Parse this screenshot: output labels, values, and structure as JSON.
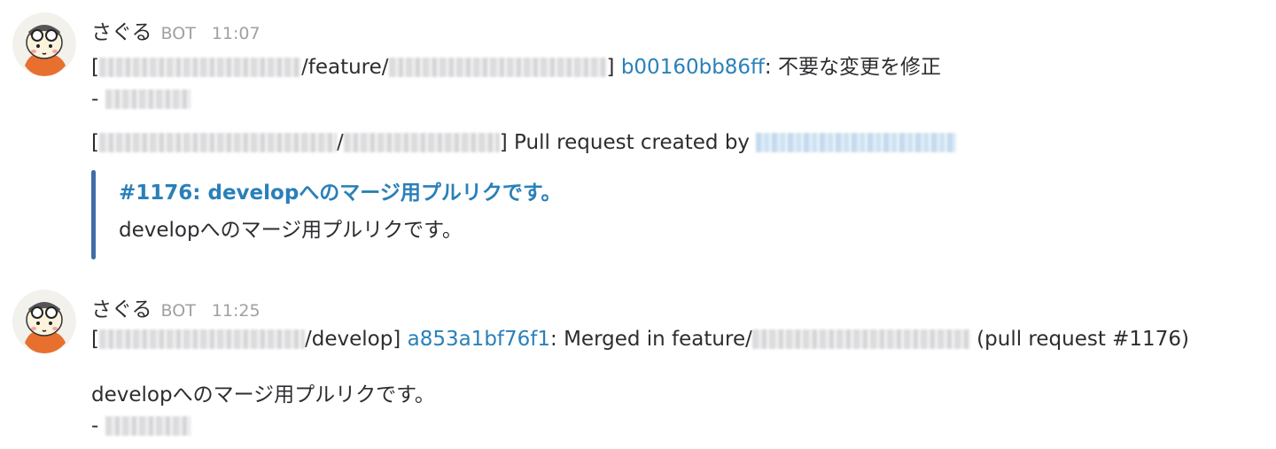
{
  "messages": [
    {
      "sender": "さぐる",
      "badge": "BOT",
      "time": "11:07",
      "commit_line": {
        "open": "[",
        "sep1": "/feature/",
        "close": "]",
        "hash": "b00160bb86ff",
        "rest": ": 不要な変更を修正"
      },
      "author_prefix": "-",
      "pr_line": {
        "open": "[",
        "sep": "/",
        "close": "]",
        "text": " Pull request created by "
      },
      "attachment": {
        "title": "#1176: developへのマージ用プルリクです。",
        "text": "developへのマージ用プルリクです。",
        "color": "#3f6ea7"
      }
    },
    {
      "sender": "さぐる",
      "badge": "BOT",
      "time": "11:25",
      "commit_line": {
        "open": "[",
        "sep1": "/develop]",
        "hash": "a853a1bf76f1",
        "rest": ": Merged in feature/",
        "tail": " (pull request #1176)"
      },
      "body": "developへのマージ用プルリクです。",
      "author_prefix": "-"
    }
  ],
  "colors": {
    "link": "#2a80b9",
    "muted": "#a0a0a2",
    "text": "#2c2d30"
  },
  "icons": {
    "avatar": "fox-pilot-avatar"
  }
}
